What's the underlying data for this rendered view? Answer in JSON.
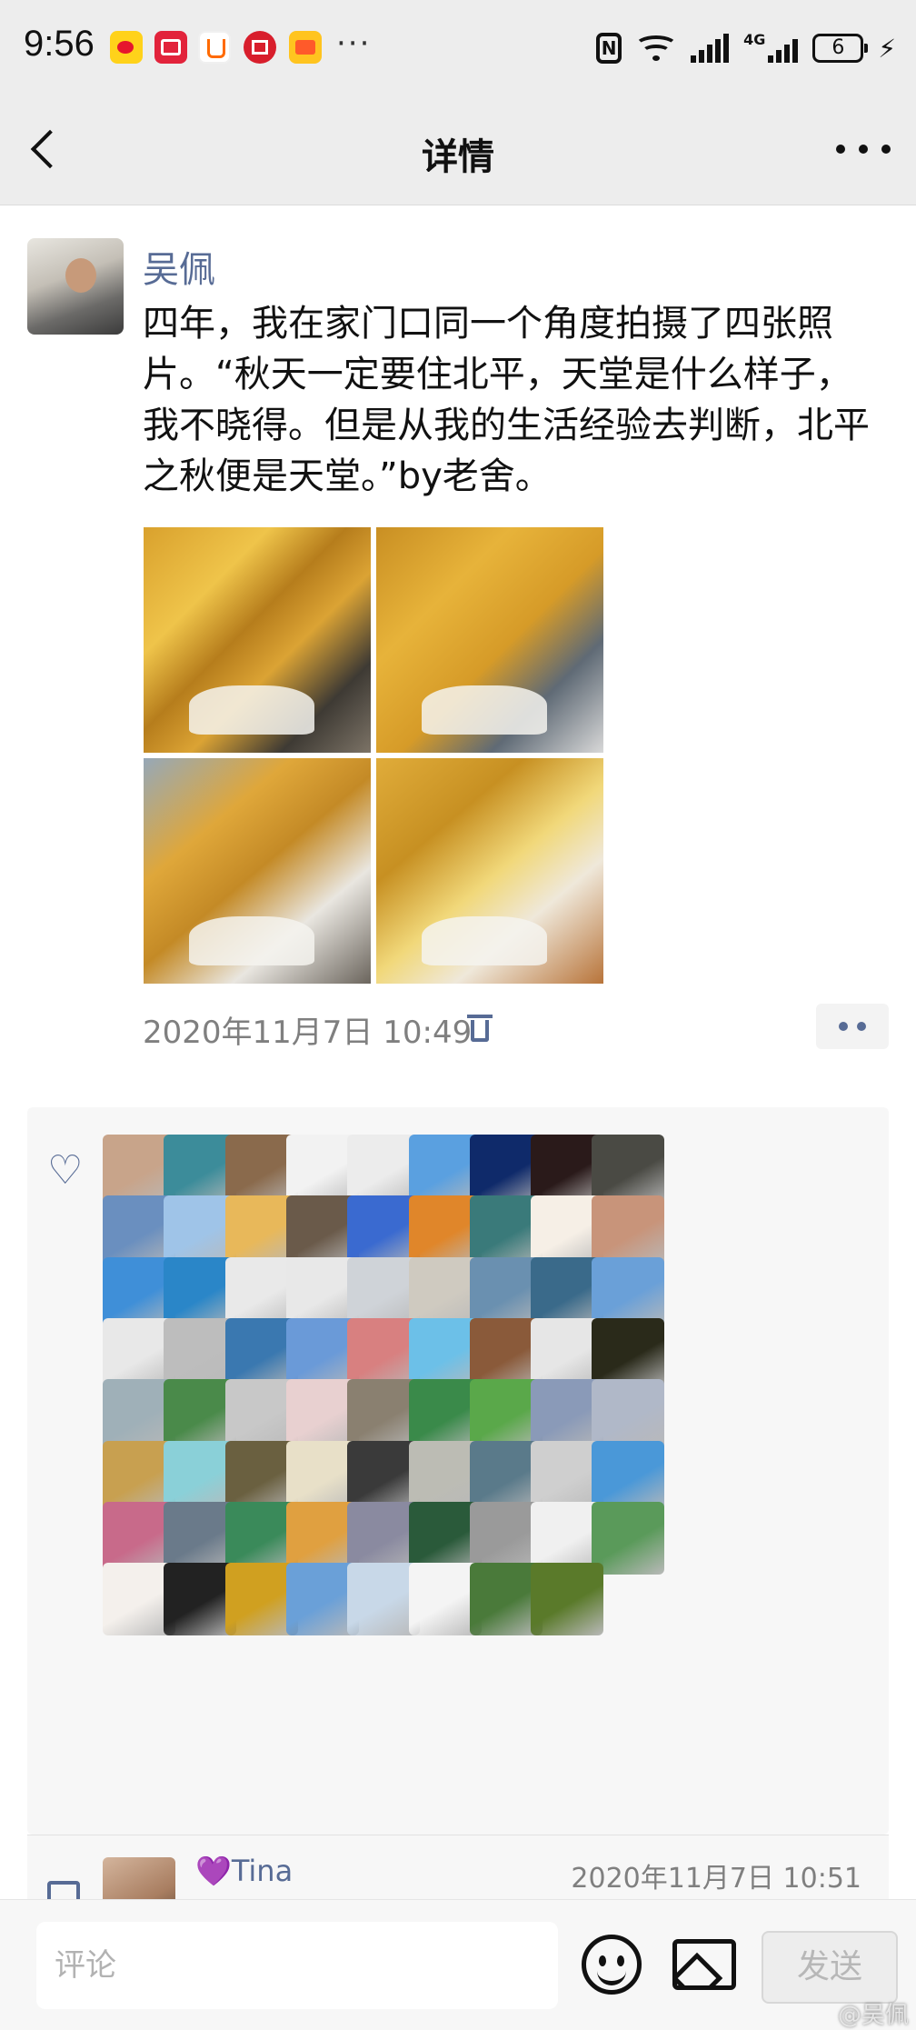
{
  "status_bar": {
    "time": "9:56",
    "more_indicator": "···",
    "signal_label": "4G",
    "battery": "6",
    "wifi_label": "6"
  },
  "header": {
    "title": "详情"
  },
  "post": {
    "author": "吴佩",
    "text": "四年，我在家门口同一个角度拍摄了四张照片。“秋天一定要住北平，天堂是什么样子，我不晓得。但是从我的生活经验去判断，北平之秋便是天堂。”by老舍。",
    "photo_count": 4,
    "timestamp": "2020年11月7日 10:49"
  },
  "likes": {
    "avatar_colors": [
      [
        "#c8a48a",
        "#3c8c9a",
        "#8a6a4c",
        "#f2f2f2",
        "#ececec",
        "#5aa0e0",
        "#0f2a6a",
        "#2a1a1a",
        "#4a4a44"
      ],
      [
        "#6a8fbf",
        "#9fc4e8",
        "#e8b85a",
        "#6a5a4a",
        "#3a6ad0",
        "#e0862a",
        "#3a7a7a",
        "#f6efe6",
        "#c8947a"
      ],
      [
        "#3f8fd8",
        "#2a86c8",
        "#e9e9e9",
        "#e8e8e8",
        "#cfd3d8",
        "#cfcac0",
        "#6a90b0",
        "#3a6a8a",
        "#6aa0d8"
      ],
      [
        "#e8e8e8",
        "#bdbdbd",
        "#3a78b0",
        "#6a9ad8",
        "#d88080",
        "#6cc0e8",
        "#8a5a3a",
        "#e6e6e6",
        "#2a2a1a"
      ],
      [
        "#9fb0b8",
        "#4a8a4a",
        "#c8c8c8",
        "#e8d0d0",
        "#8a8070",
        "#3a8a4a",
        "#5aa84a",
        "#8a9ab8",
        "#b0b8c8"
      ],
      [
        "#c8a050",
        "#8ad0d8",
        "#6a6040",
        "#e8e0c8",
        "#3a3a3a",
        "#bcbcb4",
        "#5a7a8a",
        "#cfcfcf",
        "#4a98d8"
      ],
      [
        "#c86a8a",
        "#6a7a8a",
        "#3a8a5a",
        "#e0a040",
        "#8a8aa0",
        "#2a5a3a",
        "#9a9a9a",
        "#f0f0f0",
        "#5a9a5a"
      ],
      [
        "#f4f0ec",
        "#222222",
        "#d0a020",
        "#6aa0d8",
        "#c8d8e8",
        "#f4f4f4",
        "#4a7a3a",
        "#5a7a2a"
      ]
    ]
  },
  "comment": {
    "name": "💜Tina",
    "time": "2020年11月7日 10:51"
  },
  "bottom_bar": {
    "placeholder": "评论",
    "send_label": "发送"
  },
  "watermark": "@吴佩"
}
